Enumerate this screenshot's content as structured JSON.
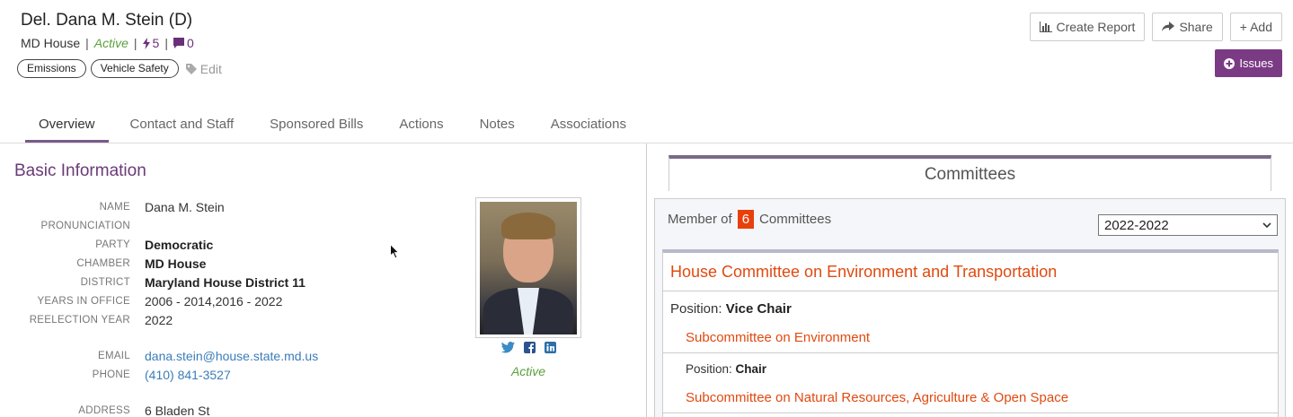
{
  "header": {
    "title": "Del. Dana M. Stein (D)",
    "chamber": "MD House",
    "status": "Active",
    "actions_count": "5",
    "notes_count": "0",
    "tags": [
      "Emissions",
      "Vehicle Safety"
    ],
    "edit_label": "Edit"
  },
  "toolbar": {
    "create_report_label": "Create Report",
    "share_label": "Share",
    "add_label": "+ Add",
    "issues_label": "Issues"
  },
  "tabs": [
    {
      "label": "Overview"
    },
    {
      "label": "Contact and Staff"
    },
    {
      "label": "Sponsored Bills"
    },
    {
      "label": "Actions"
    },
    {
      "label": "Notes"
    },
    {
      "label": "Associations"
    }
  ],
  "basic_info": {
    "section_title": "Basic Information",
    "name_label": "NAME",
    "name": "Dana M. Stein",
    "pronunciation_label": "PRONUNCIATION",
    "pronunciation": "",
    "party_label": "PARTY",
    "party": "Democratic",
    "chamber_label": "CHAMBER",
    "chamber": "MD House",
    "district_label": "DISTRICT",
    "district": "Maryland House District 11",
    "years_label": "YEARS IN OFFICE",
    "years": "2006 - 2014,2016 - 2022",
    "reelection_label": "REELECTION YEAR",
    "reelection": "2022",
    "email_label": "EMAIL",
    "email": "dana.stein@house.state.md.us",
    "phone_label": "PHONE",
    "phone": "(410) 841-3527",
    "address_label": "ADDRESS",
    "address": "6 Bladen St"
  },
  "photo": {
    "status": "Active"
  },
  "committees": {
    "tab_label": "Committees",
    "member_of_label": "Member of",
    "count": "6",
    "committees_label": "Committees",
    "year_selected": "2022-2022",
    "primary": {
      "name": "House Committee on Environment and Transportation",
      "position_label": "Position:",
      "position": "Vice Chair",
      "subcommittee": "Subcommittee on Environment"
    },
    "secondary": {
      "position_label": "Position:",
      "position": "Chair",
      "subcommittee": "Subcommittee on Natural Resources, Agriculture & Open Space"
    }
  },
  "colors": {
    "accent_purple": "#7b3b84",
    "active_green": "#5aa03c",
    "committee_orange": "#e04a10",
    "link_blue": "#3a7db8"
  }
}
